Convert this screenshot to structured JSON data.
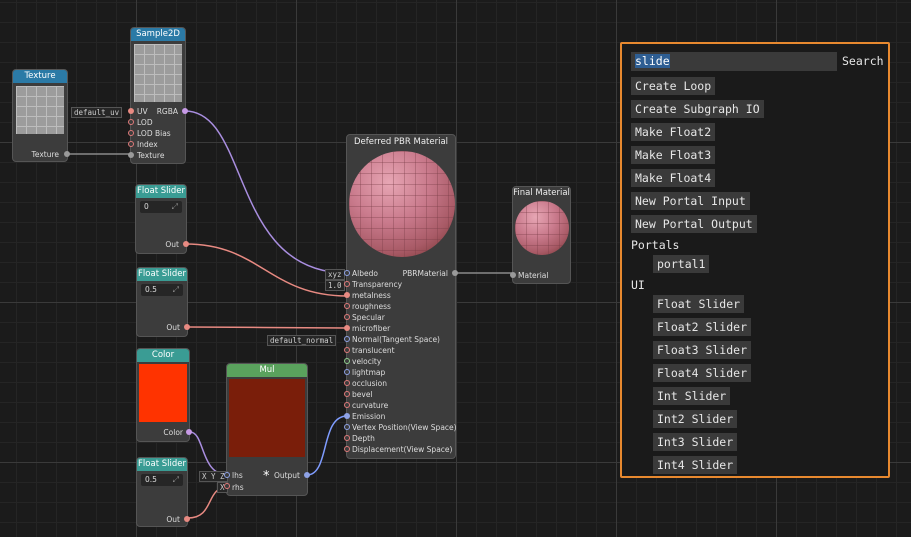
{
  "nodes": {
    "texture": {
      "title": "Texture",
      "out": "Texture"
    },
    "sample2d": {
      "title": "Sample2D",
      "uv_default": "default_uv",
      "inputs": [
        "UV",
        "LOD",
        "LOD Bias",
        "Index",
        "Texture"
      ],
      "output": "RGBA"
    },
    "float_slider_1": {
      "title": "Float Slider",
      "value": "0",
      "out": "Out"
    },
    "float_slider_2": {
      "title": "Float Slider",
      "value": "0.5",
      "out": "Out"
    },
    "float_slider_3": {
      "title": "Float Slider",
      "value": "0.5",
      "out": "Out"
    },
    "color": {
      "title": "Color",
      "out": "Color",
      "swatch": "#ff3300"
    },
    "mul": {
      "title": "Mul",
      "lhs": "lhs",
      "rhs": "rhs",
      "lhs_tag": "X Y Z",
      "rhs_tag": "X",
      "output": "Output",
      "symbol": "*",
      "swatch": "#7a1e0a"
    },
    "pbr": {
      "title": "Deferred PBR Material",
      "output": "PBRMaterial",
      "albedo_tag": "xyz",
      "transparency_tag": "1.0",
      "normal_tag": "default_normal",
      "inputs": [
        "Albedo",
        "Transparency",
        "metalness",
        "roughness",
        "Specular",
        "microfiber",
        "Normal(Tangent Space)",
        "translucent",
        "velocity",
        "lightmap",
        "occlusion",
        "bevel",
        "curvature",
        "Emission",
        "Vertex Position(View Space)",
        "Depth",
        "Displacement(View Space)"
      ]
    },
    "final": {
      "title": "Final Material",
      "input": "Material"
    }
  },
  "search_panel": {
    "query_selected": "slide",
    "search_label": "Search",
    "items": [
      "Create Loop",
      "Create Subgraph IO",
      "Make Float2",
      "Make Float3",
      "Make Float4",
      "New Portal Input",
      "New Portal Output"
    ],
    "categories": [
      {
        "label": "Portals",
        "items": [
          "portal1"
        ]
      },
      {
        "label": "UI",
        "items": [
          "Float Slider",
          "Float2 Slider",
          "Float3 Slider",
          "Float4 Slider",
          "Int Slider",
          "Int2 Slider",
          "Int3 Slider",
          "Int4 Slider"
        ]
      }
    ]
  },
  "colors": {
    "accent": "#e8892f",
    "selection": "#2e5e93",
    "wire_purple": "#a98ee0",
    "wire_red": "#e88a82",
    "wire_gray": "#8a8a8a",
    "wire_blue": "#7f9cff"
  }
}
